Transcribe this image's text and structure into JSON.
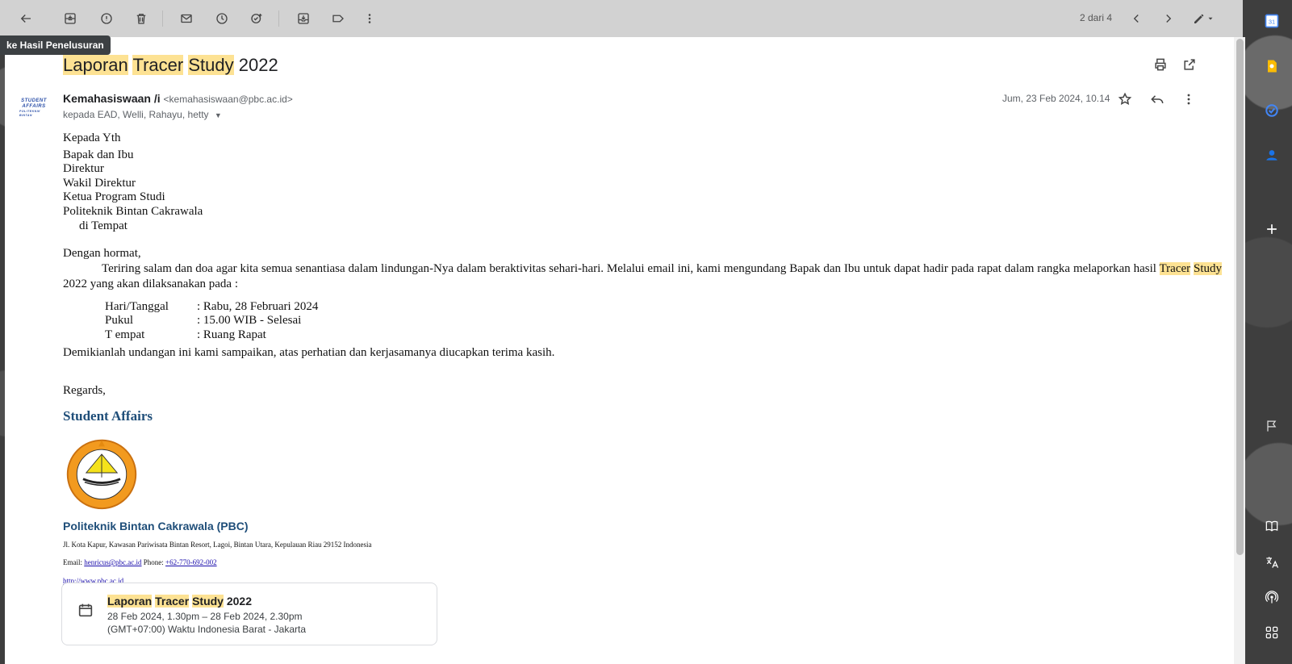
{
  "toolbar": {
    "pager": "2 dari 4",
    "tooltip": "ke Hasil Penelusuran"
  },
  "email": {
    "subject_parts": [
      "Laporan",
      "Tracer",
      "Study",
      "2022"
    ],
    "sender_name": "Kemahasiswaan /i",
    "sender_email": "<kemahasiswaan@pbc.ac.id>",
    "to_line": "kepada EAD, Welli, Rahayu, hetty",
    "date": "Jum, 23 Feb 2024, 10.14",
    "avatar_text": [
      "STUDENT",
      "AFFAIRS",
      "POLITEKNIK BINTAN"
    ]
  },
  "body": {
    "greeting": "Kepada Yth",
    "recipients": [
      "Bapak dan Ibu",
      "Direktur",
      "Wakil Direktur",
      "Ketua Program Studi",
      "Politeknik Bintan Cakrawala"
    ],
    "place": "di Tempat",
    "salutation": "Dengan hormat,",
    "para_start": "Teriring salam dan doa agar kita semua senantiasa dalam lindungan-Nya dalam beraktivitas sehari-hari. Melalui email ini, kami mengundang Bapak dan Ibu untuk dapat hadir pada rapat dalam rangka melaporkan hasil",
    "para_hl1": "Tracer",
    "para_hl2": "Study",
    "para_end": "2022 yang akan dilaksanakan pada :",
    "details": [
      {
        "label": "Hari/Tanggal",
        "value": ": Rabu, 28 Februari 2024"
      },
      {
        "label": "Pukul",
        "value": ": 15.00 WIB - Selesai"
      },
      {
        "label": "T empat",
        "value": ": Ruang Rapat"
      }
    ],
    "closing": "Demikianlah undangan ini kami sampaikan, atas perhatian dan kerjasamanya diucapkan terima kasih.",
    "regards": "Regards,"
  },
  "signature": {
    "title": "Student Affairs",
    "logo_text": "POLITEKNIK BINTAN CAKRAWALA",
    "org": "Politeknik Bintan Cakrawala (PBC)",
    "address": "Jl. Kota Kapur, Kawasan Pariwisata Bintan Resort, Lagoi, Bintan Utara, Kepulauan Riau 29152 Indonesia",
    "email_label": "Email: ",
    "email": "henricus@pbc.ac.id",
    "phone_label": " Phone: ",
    "phone": "+62-770-692-002",
    "website": "http://www.pbc.ac.id"
  },
  "event": {
    "title_parts": [
      "Laporan",
      "Tracer",
      "Study",
      "2022"
    ],
    "date": "28 Feb 2024, 1.30pm – 28 Feb 2024, 2.30pm",
    "tz": "(GMT+07:00) Waktu Indonesia Barat - Jakarta"
  },
  "colors": {
    "highlight": "#fde293",
    "signature_blue": "#1f4e79",
    "link": "#1a0dab"
  }
}
